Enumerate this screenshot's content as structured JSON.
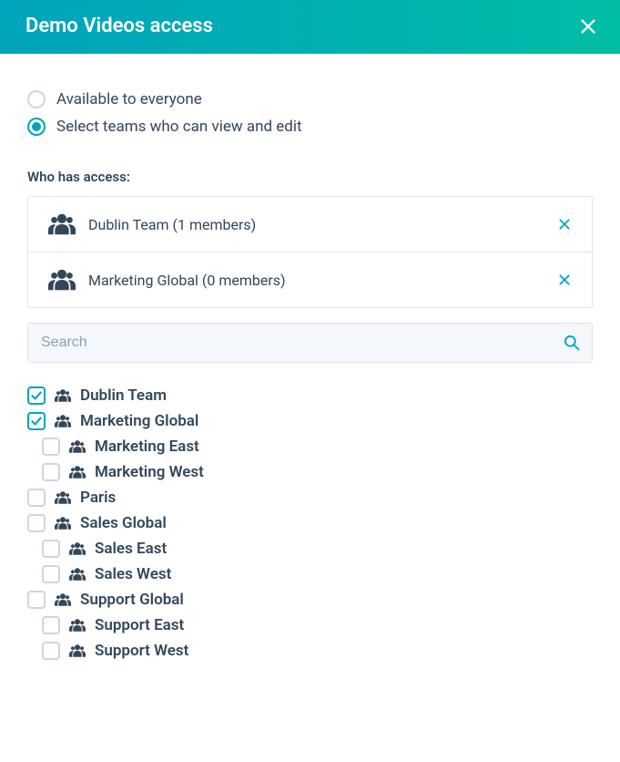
{
  "header": {
    "title": "Demo Videos access"
  },
  "options": {
    "everyone": "Available to everyone",
    "select_teams": "Select teams who can view and edit",
    "selected": "select_teams"
  },
  "access": {
    "label": "Who has access:",
    "items": [
      {
        "label": "Dublin Team (1 members)"
      },
      {
        "label": "Marketing Global (0 members)"
      }
    ]
  },
  "search": {
    "placeholder": "Search",
    "value": ""
  },
  "tree": [
    {
      "label": "Dublin Team",
      "checked": true,
      "level": 0
    },
    {
      "label": "Marketing Global",
      "checked": true,
      "level": 0
    },
    {
      "label": "Marketing East",
      "checked": false,
      "level": 1
    },
    {
      "label": "Marketing West",
      "checked": false,
      "level": 1
    },
    {
      "label": "Paris",
      "checked": false,
      "level": 0
    },
    {
      "label": "Sales Global",
      "checked": false,
      "level": 0
    },
    {
      "label": "Sales East",
      "checked": false,
      "level": 1
    },
    {
      "label": "Sales West",
      "checked": false,
      "level": 1
    },
    {
      "label": "Support Global",
      "checked": false,
      "level": 0
    },
    {
      "label": "Support East",
      "checked": false,
      "level": 1
    },
    {
      "label": "Support West",
      "checked": false,
      "level": 1
    }
  ]
}
